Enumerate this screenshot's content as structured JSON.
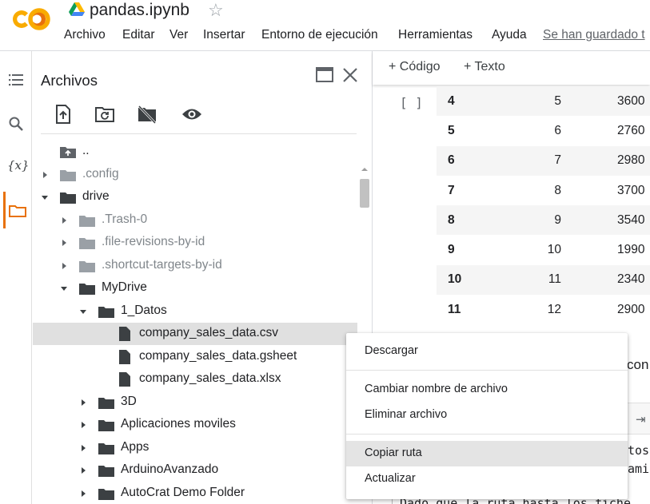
{
  "header": {
    "title": "pandas.ipynb",
    "menu": [
      "Archivo",
      "Editar",
      "Ver",
      "Insertar",
      "Entorno de ejecución",
      "Herramientas",
      "Ayuda"
    ],
    "saved_status": "Se han guardado t"
  },
  "rail": {
    "icons": [
      "toc-icon",
      "search-icon",
      "variables-icon",
      "folder-icon"
    ],
    "variables_symbol": "{x}",
    "active": "folder-icon"
  },
  "files": {
    "title": "Archivos",
    "tools": [
      "upload-icon",
      "folder-refresh-icon",
      "drive-off-icon",
      "visibility-icon"
    ],
    "tree": [
      {
        "label": "..",
        "type": "up",
        "depth": 0
      },
      {
        "label": ".config",
        "type": "folder",
        "depth": 0,
        "expanded": false,
        "dim": true
      },
      {
        "label": "drive",
        "type": "folder",
        "depth": 0,
        "expanded": true
      },
      {
        "label": ".Trash-0",
        "type": "folder",
        "depth": 1,
        "expanded": false,
        "dim": true
      },
      {
        "label": ".file-revisions-by-id",
        "type": "folder",
        "depth": 1,
        "expanded": false,
        "dim": true
      },
      {
        "label": ".shortcut-targets-by-id",
        "type": "folder",
        "depth": 1,
        "expanded": false,
        "dim": true
      },
      {
        "label": "MyDrive",
        "type": "folder",
        "depth": 1,
        "expanded": true
      },
      {
        "label": "1_Datos",
        "type": "folder",
        "depth": 2,
        "expanded": true
      },
      {
        "label": "company_sales_data.csv",
        "type": "file",
        "depth": 3,
        "selected": true
      },
      {
        "label": "company_sales_data.gsheet",
        "type": "file",
        "depth": 3
      },
      {
        "label": "company_sales_data.xlsx",
        "type": "file",
        "depth": 3
      },
      {
        "label": "3D",
        "type": "folder",
        "depth": 2,
        "expanded": false
      },
      {
        "label": "Aplicaciones moviles",
        "type": "folder",
        "depth": 2,
        "expanded": false
      },
      {
        "label": "Apps",
        "type": "folder",
        "depth": 2,
        "expanded": false
      },
      {
        "label": "ArduinoAvanzado",
        "type": "folder",
        "depth": 2,
        "expanded": false
      },
      {
        "label": "AutoCrat Demo Folder",
        "type": "folder",
        "depth": 2,
        "expanded": false
      }
    ]
  },
  "notebook": {
    "toolbar": {
      "code": "+ Código",
      "text": "+ Texto"
    },
    "run_bracket": "[ ]",
    "table_rows": [
      [
        "4",
        "5",
        "3600"
      ],
      [
        "5",
        "6",
        "2760"
      ],
      [
        "6",
        "7",
        "2980"
      ],
      [
        "7",
        "8",
        "3700"
      ],
      [
        "8",
        "9",
        "3540"
      ],
      [
        "9",
        "10",
        "1990"
      ],
      [
        "10",
        "11",
        "2340"
      ],
      [
        "11",
        "12",
        "2900"
      ]
    ],
    "output_fragment": "con",
    "code_line_1": "tos",
    "code_line_2": "amie",
    "markdown_line": "Dado que la ruta hasta los fiche"
  },
  "context_menu": {
    "groups": [
      [
        "Descargar"
      ],
      [
        "Cambiar nombre de archivo",
        "Eliminar archivo"
      ],
      [
        "Copiar ruta",
        "Actualizar"
      ]
    ],
    "hovered": "Copiar ruta"
  }
}
